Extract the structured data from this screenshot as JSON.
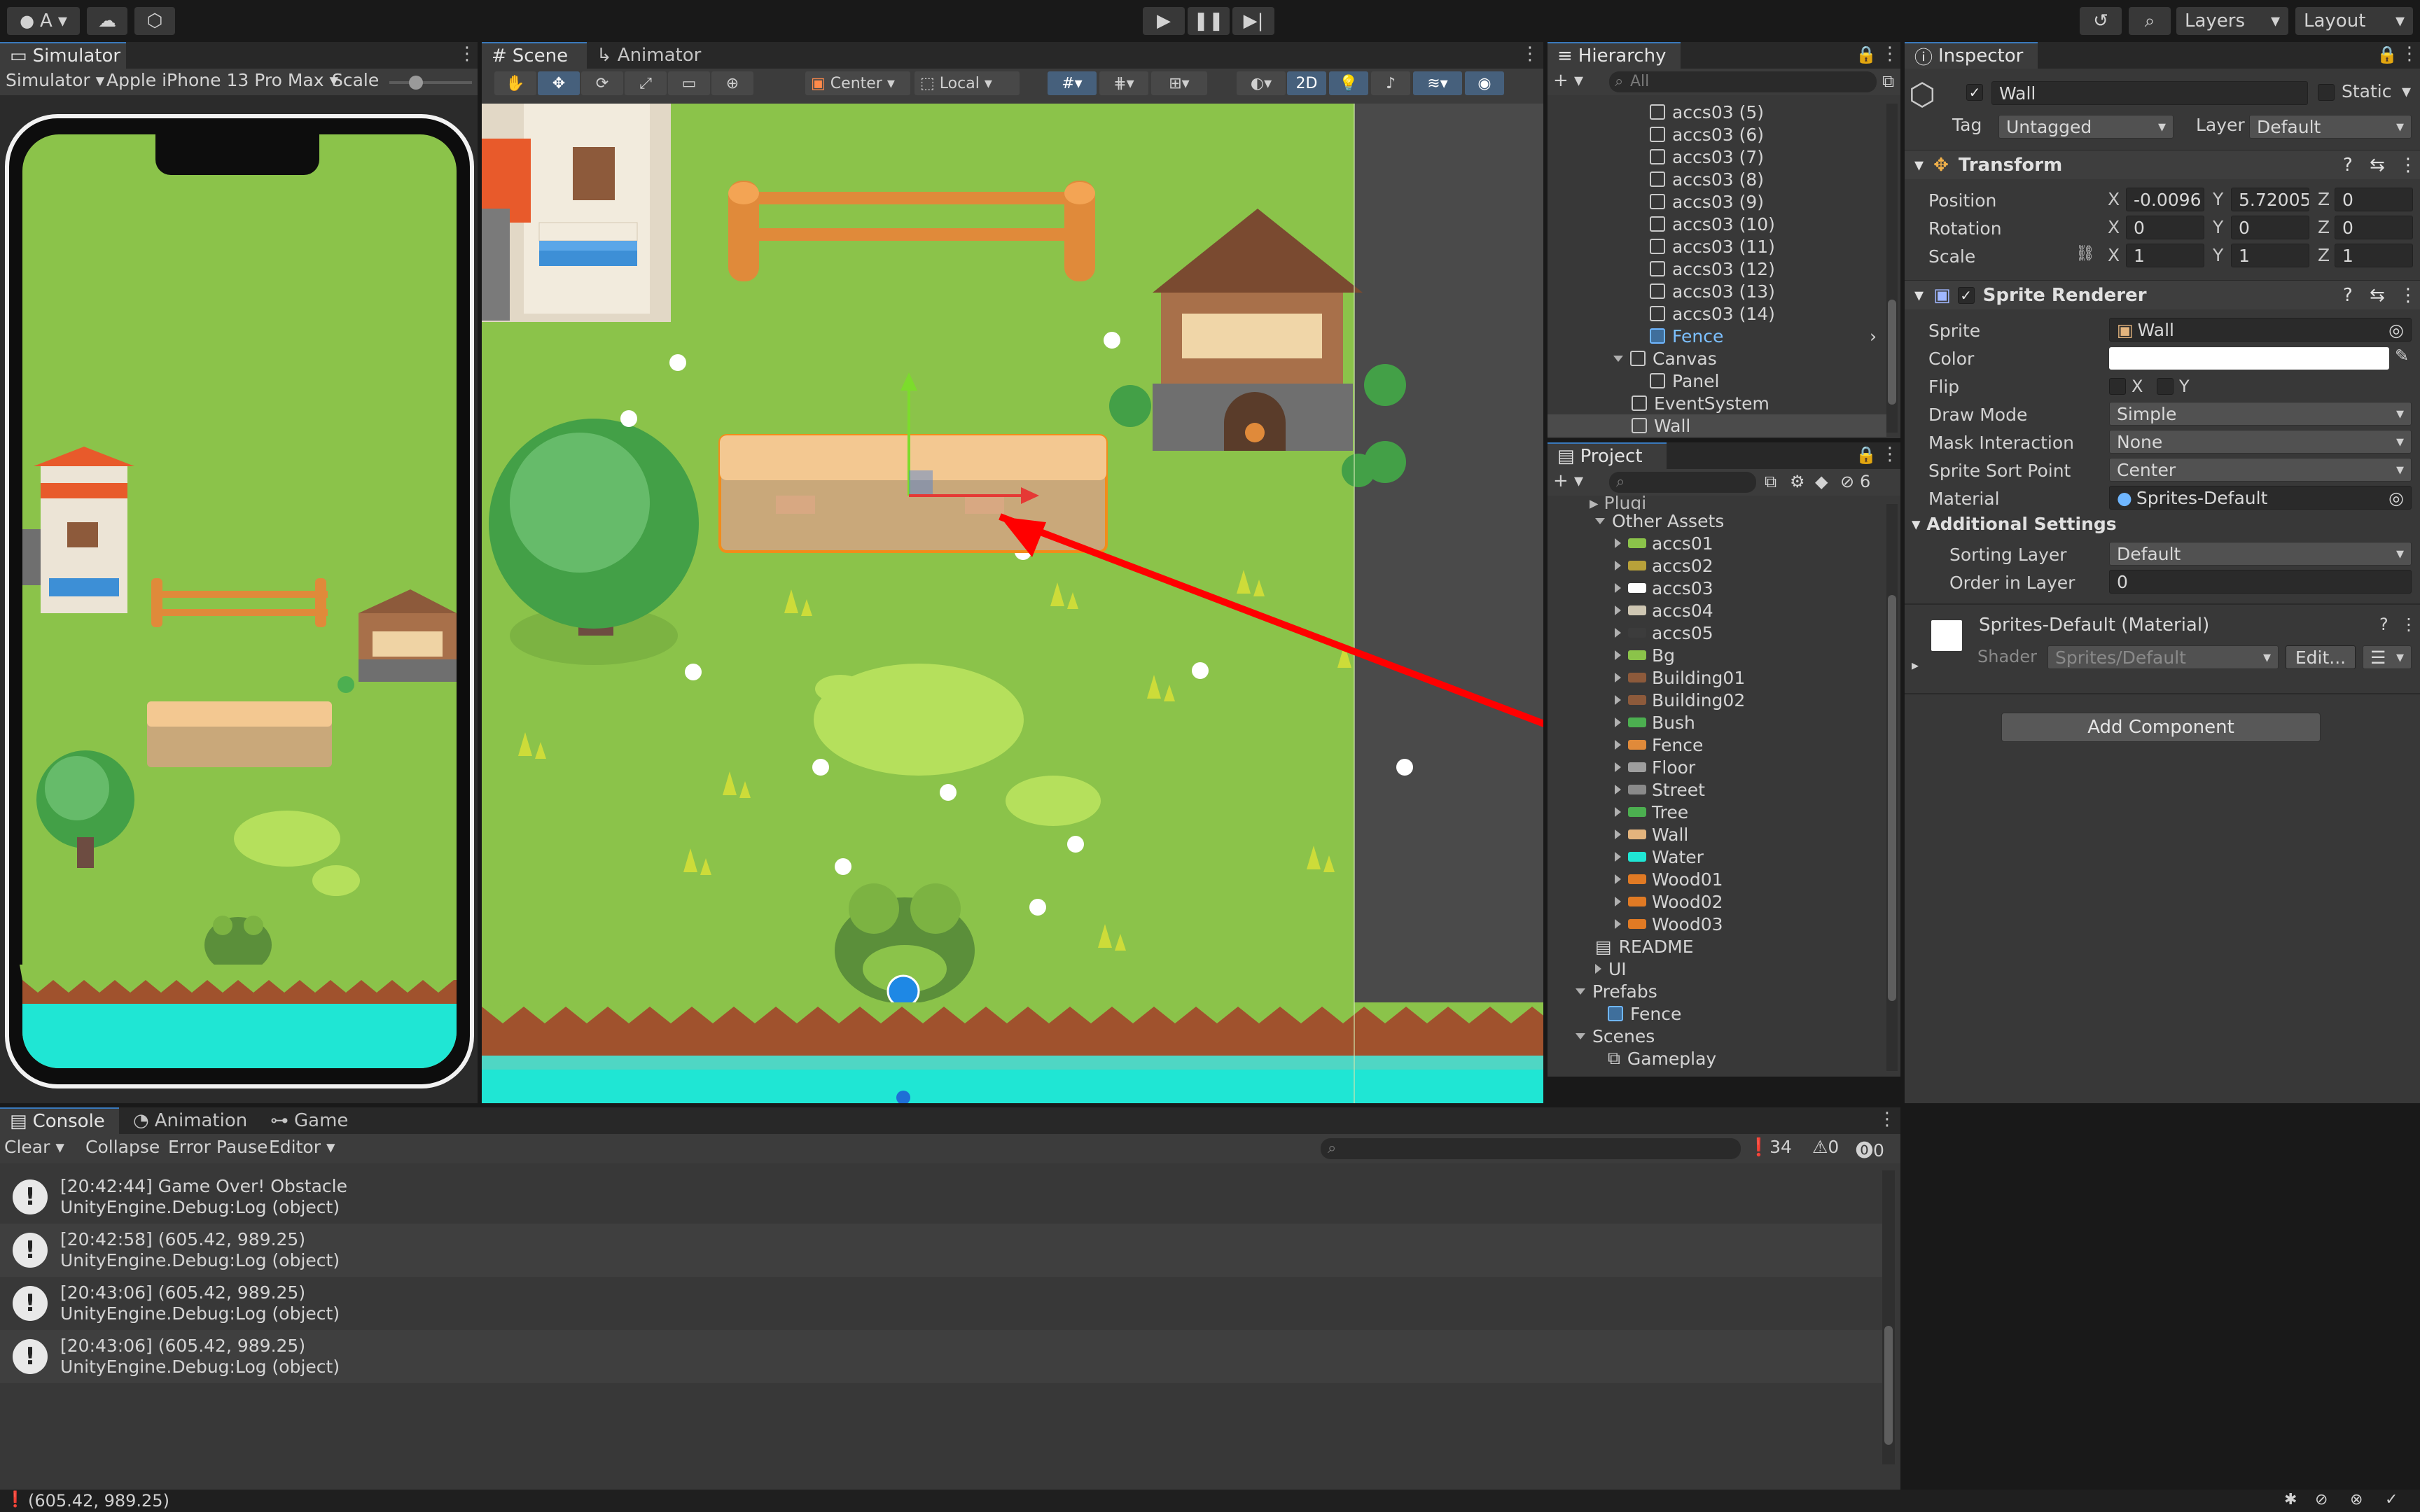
{
  "topbar": {
    "account_label": "A",
    "play_icon": "play-icon",
    "pause_icon": "pause-icon",
    "step_icon": "step-icon",
    "layers_label": "Layers",
    "layout_label": "Layout"
  },
  "simulator": {
    "tab_label": "Simulator",
    "mode_label": "Simulator",
    "device_label": "Apple iPhone 13 Pro Max",
    "scale_label": "Scale"
  },
  "scene": {
    "tabs": [
      "Scene",
      "Animator"
    ],
    "pivot_label": "Center",
    "space_label": "Local",
    "mode_2d_label": "2D"
  },
  "hierarchy": {
    "tab_label": "Hierarchy",
    "search_placeholder": "All",
    "items": [
      {
        "label": "accs03 (5)",
        "type": "object"
      },
      {
        "label": "accs03 (6)",
        "type": "object"
      },
      {
        "label": "accs03 (7)",
        "type": "object"
      },
      {
        "label": "accs03 (8)",
        "type": "object"
      },
      {
        "label": "accs03 (9)",
        "type": "object"
      },
      {
        "label": "accs03 (10)",
        "type": "object"
      },
      {
        "label": "accs03 (11)",
        "type": "object"
      },
      {
        "label": "accs03 (12)",
        "type": "object"
      },
      {
        "label": "accs03 (13)",
        "type": "object"
      },
      {
        "label": "accs03 (14)",
        "type": "object"
      },
      {
        "label": "Fence",
        "type": "prefab"
      },
      {
        "label": "Canvas",
        "type": "object"
      },
      {
        "label": "Panel",
        "type": "object"
      },
      {
        "label": "EventSystem",
        "type": "object"
      },
      {
        "label": "Wall",
        "type": "object"
      }
    ]
  },
  "project": {
    "tab_label": "Project",
    "hidden_count": "6",
    "items": [
      {
        "label": "Other Assets",
        "kind": "folder"
      },
      {
        "label": "accs01",
        "kind": "asset",
        "color": "#8bc34a"
      },
      {
        "label": "accs02",
        "kind": "asset",
        "color": "#b8a13a"
      },
      {
        "label": "accs03",
        "kind": "asset",
        "color": "#ffffff"
      },
      {
        "label": "accs04",
        "kind": "asset",
        "color": "#cfc7b3"
      },
      {
        "label": "accs05",
        "kind": "asset",
        "color": "#3c3c3c"
      },
      {
        "label": "Bg",
        "kind": "asset",
        "color": "#8bc34a"
      },
      {
        "label": "Building01",
        "kind": "asset",
        "color": "#8d5a3b"
      },
      {
        "label": "Building02",
        "kind": "asset",
        "color": "#8d5a3b"
      },
      {
        "label": "Bush",
        "kind": "asset",
        "color": "#4caf50"
      },
      {
        "label": "Fence",
        "kind": "asset",
        "color": "#e08a3a"
      },
      {
        "label": "Floor",
        "kind": "asset",
        "color": "#9e9e9e"
      },
      {
        "label": "Street",
        "kind": "asset",
        "color": "#8a8a8a"
      },
      {
        "label": "Tree",
        "kind": "asset",
        "color": "#4caf50"
      },
      {
        "label": "Wall",
        "kind": "asset",
        "color": "#e3b47d"
      },
      {
        "label": "Water",
        "kind": "asset",
        "color": "#1fe6d4"
      },
      {
        "label": "Wood01",
        "kind": "asset",
        "color": "#e07a24"
      },
      {
        "label": "Wood02",
        "kind": "asset",
        "color": "#e07a24"
      },
      {
        "label": "Wood03",
        "kind": "asset",
        "color": "#e07a24"
      },
      {
        "label": "README",
        "kind": "file"
      },
      {
        "label": "UI",
        "kind": "folder"
      },
      {
        "label": "Prefabs",
        "kind": "folder"
      },
      {
        "label": "Fence",
        "kind": "prefab"
      },
      {
        "label": "Scenes",
        "kind": "folder"
      },
      {
        "label": "Gameplay",
        "kind": "scene"
      }
    ]
  },
  "inspector": {
    "tab_label": "Inspector",
    "object_name": "Wall",
    "static_label": "Static",
    "tag_label": "Tag",
    "tag_value": "Untagged",
    "layer_label": "Layer",
    "layer_value": "Default",
    "transform": {
      "title": "Transform",
      "position_label": "Position",
      "rotation_label": "Rotation",
      "scale_label": "Scale",
      "pos_x": "-0.0096",
      "pos_y": "5.72005",
      "pos_z": "0",
      "rot_x": "0",
      "rot_y": "0",
      "rot_z": "0",
      "scl_x": "1",
      "scl_y": "1",
      "scl_z": "1"
    },
    "sprite_renderer": {
      "title": "Sprite Renderer",
      "sprite_label": "Sprite",
      "sprite_value": "Wall",
      "color_label": "Color",
      "color_value": "#ffffff",
      "flip_label": "Flip",
      "flip_x": "X",
      "flip_y": "Y",
      "draw_mode_label": "Draw Mode",
      "draw_mode_value": "Simple",
      "mask_label": "Mask Interaction",
      "mask_value": "None",
      "sort_point_label": "Sprite Sort Point",
      "sort_point_value": "Center",
      "material_label": "Material",
      "material_value": "Sprites-Default",
      "additional_label": "Additional Settings",
      "sorting_layer_label": "Sorting Layer",
      "sorting_layer_value": "Default",
      "order_label": "Order in Layer",
      "order_value": "0"
    },
    "material": {
      "title": "Sprites-Default (Material)",
      "shader_label": "Shader",
      "shader_value": "Sprites/Default",
      "edit_label": "Edit..."
    },
    "add_component_label": "Add Component"
  },
  "console": {
    "tabs": [
      "Console",
      "Animation",
      "Game"
    ],
    "clear_label": "Clear",
    "collapse_label": "Collapse",
    "error_pause_label": "Error Pause",
    "editor_label": "Editor",
    "count_info": "34",
    "count_warn": "0",
    "count_error": "0",
    "logs": [
      {
        "line1": "[20:42:44] Game Over! Obstacle",
        "line2": "UnityEngine.Debug:Log (object)"
      },
      {
        "line1": "[20:42:58] (605.42, 989.25)",
        "line2": "UnityEngine.Debug:Log (object)"
      },
      {
        "line1": "[20:43:06] (605.42, 989.25)",
        "line2": "UnityEngine.Debug:Log (object)"
      },
      {
        "line1": "[20:43:06] (605.42, 989.25)",
        "line2": "UnityEngine.Debug:Log (object)"
      }
    ]
  },
  "statusbar": {
    "message": "(605.42, 989.25)"
  },
  "colors": {
    "grass": "#8bc34a",
    "water": "#1fe6d4",
    "accent": "#3a79bb",
    "arrow": "#ff0000"
  }
}
